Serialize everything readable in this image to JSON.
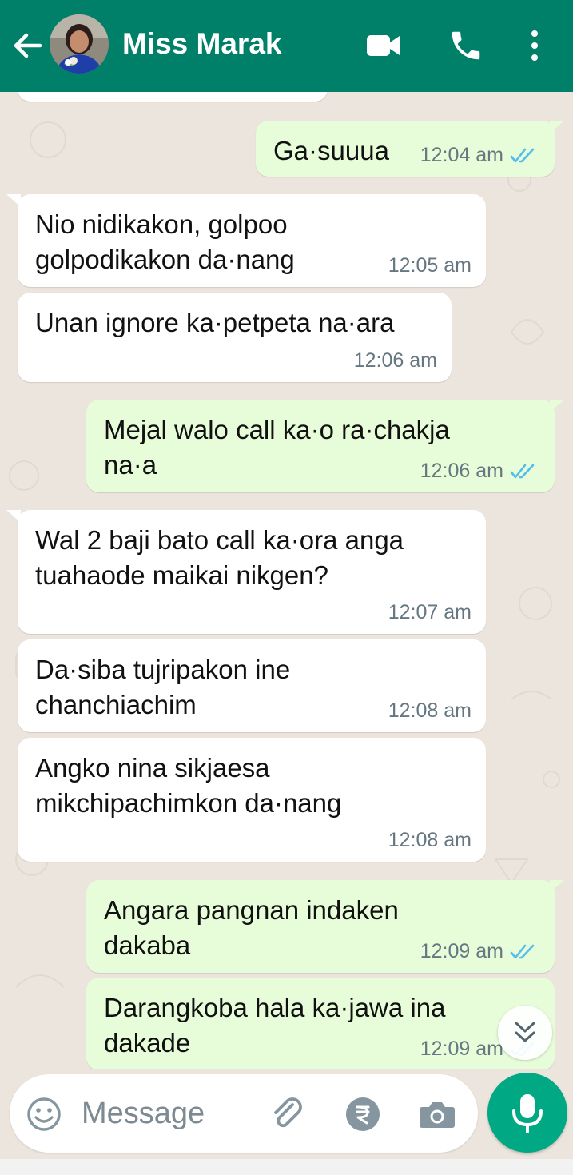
{
  "header": {
    "contact_name": "Miss Marak",
    "icons": [
      "back-arrow-icon",
      "video-call-icon",
      "voice-call-icon",
      "more-options-icon"
    ]
  },
  "messages": [
    {
      "direction": "out",
      "lines": [
        "Ga·suuua"
      ],
      "time": "12:04 am",
      "status": "read"
    },
    {
      "direction": "in",
      "lines": [
        "Nio nidikakon, golpoo",
        "golpodikakon da·nang"
      ],
      "time": "12:05 am"
    },
    {
      "direction": "in",
      "lines": [
        "Unan ignore ka·petpeta na·ara"
      ],
      "time": "12:06 am"
    },
    {
      "direction": "out",
      "lines": [
        "Mejal walo call ka·o ra·chakja",
        "na·a"
      ],
      "time": "12:06 am",
      "status": "read"
    },
    {
      "direction": "in",
      "lines": [
        "Wal 2 baji bato call ka·ora anga",
        "tuahaode maikai nikgen?"
      ],
      "time": "12:07 am"
    },
    {
      "direction": "in",
      "lines": [
        "Da·siba tujripakon ine",
        "chanchiachim"
      ],
      "time": "12:08 am"
    },
    {
      "direction": "in",
      "lines": [
        "Angko nina sikjaesa",
        "mikchipachimkon da·nang"
      ],
      "time": "12:08 am"
    },
    {
      "direction": "out",
      "lines": [
        "Angara pangnan indaken",
        "dakaba"
      ],
      "time": "12:09 am",
      "status": "read"
    },
    {
      "direction": "out",
      "lines": [
        "Darangkoba hala ka·jawa ina",
        "dakade"
      ],
      "time": "12:09 am",
      "status": "read"
    }
  ],
  "composer": {
    "placeholder": "Message",
    "icons": [
      "emoji-icon",
      "attach-icon",
      "rupee-payment-icon",
      "camera-icon",
      "mic-icon"
    ]
  },
  "colors": {
    "header": "#008069",
    "incoming_bubble": "#ffffff",
    "outgoing_bubble": "#e7fcd8",
    "read_tick": "#53bdeb",
    "mic_button": "#00a884",
    "chat_background": "#ece5dd"
  }
}
